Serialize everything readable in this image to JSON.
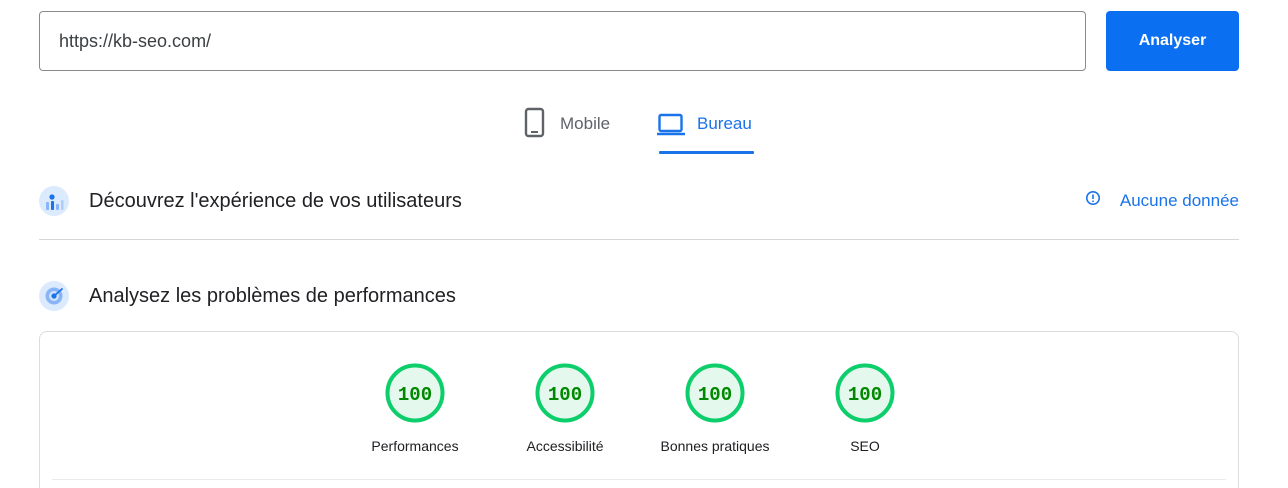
{
  "url_bar": {
    "value": "https://kb-seo.com/",
    "button_label": "Analyser",
    "accent_color": "#0b6ff2"
  },
  "device_tabs": [
    {
      "label": "Mobile",
      "icon": "smartphone-icon",
      "selected": false
    },
    {
      "label": "Bureau",
      "icon": "laptop-icon",
      "selected": true
    }
  ],
  "field_data": {
    "title": "Découvrez l'expérience de vos utilisateurs",
    "icon": "users-chart-icon",
    "status_label": "Aucune donnée",
    "status_icon": "info-icon"
  },
  "lab_data": {
    "title": "Analysez les problèmes de performances",
    "icon": "speed-gauge-icon"
  },
  "scores": [
    {
      "label": "Performances",
      "value": 100
    },
    {
      "label": "Accessibilité",
      "value": 100
    },
    {
      "label": "Bonnes pratiques",
      "value": 100
    },
    {
      "label": "SEO",
      "value": 100
    }
  ],
  "colors": {
    "score_good_ring": "#0cce6b",
    "score_good_fill": "#e5f8ed",
    "score_good_text": "#008800",
    "link_blue": "#1a73e8"
  }
}
